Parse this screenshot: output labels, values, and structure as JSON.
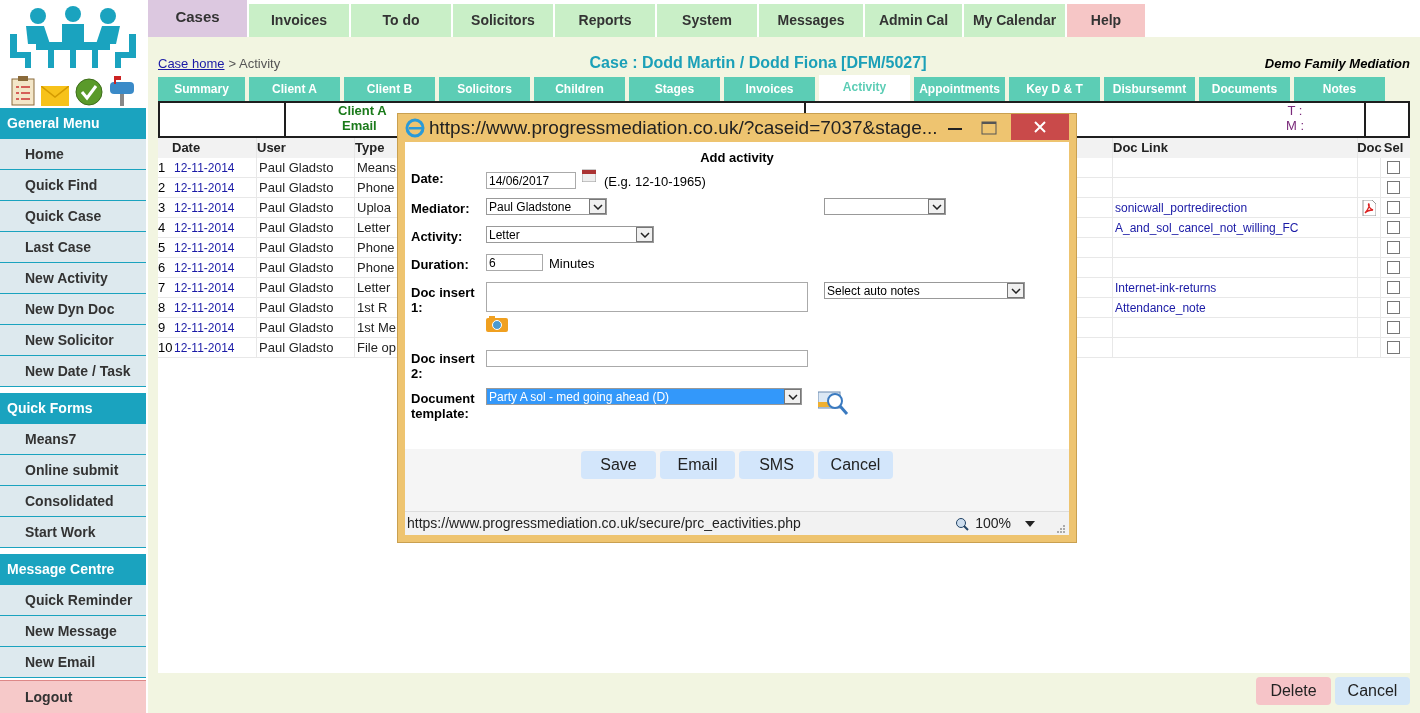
{
  "sidebar": {
    "sections": [
      {
        "title": "General Menu",
        "items": [
          "Home",
          "Quick Find",
          "Quick Case",
          "Last Case",
          "New Activity",
          "New Dyn Doc",
          "New Solicitor",
          "New Date / Task"
        ]
      },
      {
        "title": "Quick Forms",
        "items": [
          "Means7",
          "Online submit",
          "Consolidated",
          "Start Work"
        ]
      },
      {
        "title": "Message Centre",
        "items": [
          "Quick Reminder",
          "New Message",
          "New Email"
        ]
      }
    ],
    "logout": "Logout"
  },
  "top_tabs": [
    {
      "label": "Cases",
      "selected": true,
      "kind": "normal"
    },
    {
      "label": "Invoices",
      "selected": false,
      "kind": "normal"
    },
    {
      "label": "To do",
      "selected": false,
      "kind": "normal"
    },
    {
      "label": "Solicitors",
      "selected": false,
      "kind": "normal"
    },
    {
      "label": "Reports",
      "selected": false,
      "kind": "normal"
    },
    {
      "label": "System",
      "selected": false,
      "kind": "normal"
    },
    {
      "label": "Messages",
      "selected": false,
      "kind": "normal"
    },
    {
      "label": "Admin Cal",
      "selected": false,
      "kind": "normal"
    },
    {
      "label": "My Calendar",
      "selected": false,
      "kind": "normal"
    },
    {
      "label": "Help",
      "selected": false,
      "kind": "help"
    }
  ],
  "breadcrumb": {
    "link": "Case home",
    "separator": ">",
    "current": "Activity"
  },
  "case_title": "Case : Dodd Martin / Dodd Fiona [DFM/5027]",
  "organisation": "Demo Family Mediation",
  "sub_tabs": [
    {
      "label": "Summary",
      "selected": false
    },
    {
      "label": "Client A",
      "selected": false
    },
    {
      "label": "Client B",
      "selected": false
    },
    {
      "label": "Solicitors",
      "selected": false
    },
    {
      "label": "Children",
      "selected": false
    },
    {
      "label": "Stages",
      "selected": false
    },
    {
      "label": "Invoices",
      "selected": false
    },
    {
      "label": "Activity",
      "selected": true
    },
    {
      "label": "Appointments",
      "selected": false
    },
    {
      "label": "Key D & T",
      "selected": false
    },
    {
      "label": "Disbursemnt",
      "selected": false
    },
    {
      "label": "Documents",
      "selected": false
    },
    {
      "label": "Notes",
      "selected": false
    }
  ],
  "info_box": {
    "client_a": "Client A",
    "email": "Email",
    "t": "T :",
    "m": "M :"
  },
  "table": {
    "columns": [
      "Date",
      "User",
      "Type",
      "Doc Link",
      "Doc",
      "Sel"
    ],
    "rows": [
      {
        "num": "1",
        "date": "12-11-2014",
        "user": "Paul Gladsto",
        "type": "Means",
        "doc_link": "",
        "has_pdf": false,
        "checked": false
      },
      {
        "num": "2",
        "date": "12-11-2014",
        "user": "Paul Gladsto",
        "type": "Phone",
        "doc_link": "",
        "has_pdf": false,
        "checked": false
      },
      {
        "num": "3",
        "date": "12-11-2014",
        "user": "Paul Gladsto",
        "type": "Uploa",
        "doc_link": "sonicwall_portredirection",
        "has_pdf": true,
        "checked": false
      },
      {
        "num": "4",
        "date": "12-11-2014",
        "user": "Paul Gladsto",
        "type": "Letter",
        "doc_link": "A_and_sol_cancel_not_willing_FC",
        "has_pdf": false,
        "checked": false
      },
      {
        "num": "5",
        "date": "12-11-2014",
        "user": "Paul Gladsto",
        "type": "Phone",
        "doc_link": "",
        "has_pdf": false,
        "checked": false
      },
      {
        "num": "6",
        "date": "12-11-2014",
        "user": "Paul Gladsto",
        "type": "Phone",
        "doc_link": "",
        "has_pdf": false,
        "checked": false
      },
      {
        "num": "7",
        "date": "12-11-2014",
        "user": "Paul Gladsto",
        "type": "Letter",
        "doc_link": "Internet-ink-returns",
        "has_pdf": false,
        "checked": false
      },
      {
        "num": "8",
        "date": "12-11-2014",
        "user": "Paul Gladsto",
        "type": "1st R",
        "doc_link": "Attendance_note",
        "has_pdf": false,
        "checked": false
      },
      {
        "num": "9",
        "date": "12-11-2014",
        "user": "Paul Gladsto",
        "type": "1st Me",
        "doc_link": "",
        "has_pdf": false,
        "checked": false
      },
      {
        "num": "10",
        "date": "12-11-2014",
        "user": "Paul Gladsto",
        "type": "File op",
        "doc_link": "",
        "has_pdf": false,
        "checked": false
      }
    ]
  },
  "dialog": {
    "title": "https://www.progressmediation.co.uk/?caseid=7037&stage...",
    "heading": "Add activity",
    "date": {
      "label": "Date:",
      "value": "14/06/2017",
      "hint": "(E.g. 12-10-1965)"
    },
    "mediator": {
      "label": "Mediator:",
      "value": "Paul Gladstone"
    },
    "activity": {
      "label": "Activity:",
      "value": "Letter"
    },
    "duration": {
      "label": "Duration:",
      "value": "6",
      "unit": "Minutes"
    },
    "doc_insert_1": {
      "label": "Doc insert 1:"
    },
    "auto_notes": {
      "value": "Select auto notes"
    },
    "doc_insert_2": {
      "label": "Doc insert 2:"
    },
    "template": {
      "label": "Document template:",
      "value": "Party A sol - med going ahead (D)",
      "highlighted": true
    },
    "buttons": [
      "Save",
      "Email",
      "SMS",
      "Cancel"
    ],
    "status_url": "https://www.progressmediation.co.uk/secure/prc_eactivities.php",
    "zoom": "100%"
  },
  "buttons": [
    {
      "label": "Delete",
      "kind": "danger"
    },
    {
      "label": "Cancel",
      "kind": "normal"
    }
  ]
}
